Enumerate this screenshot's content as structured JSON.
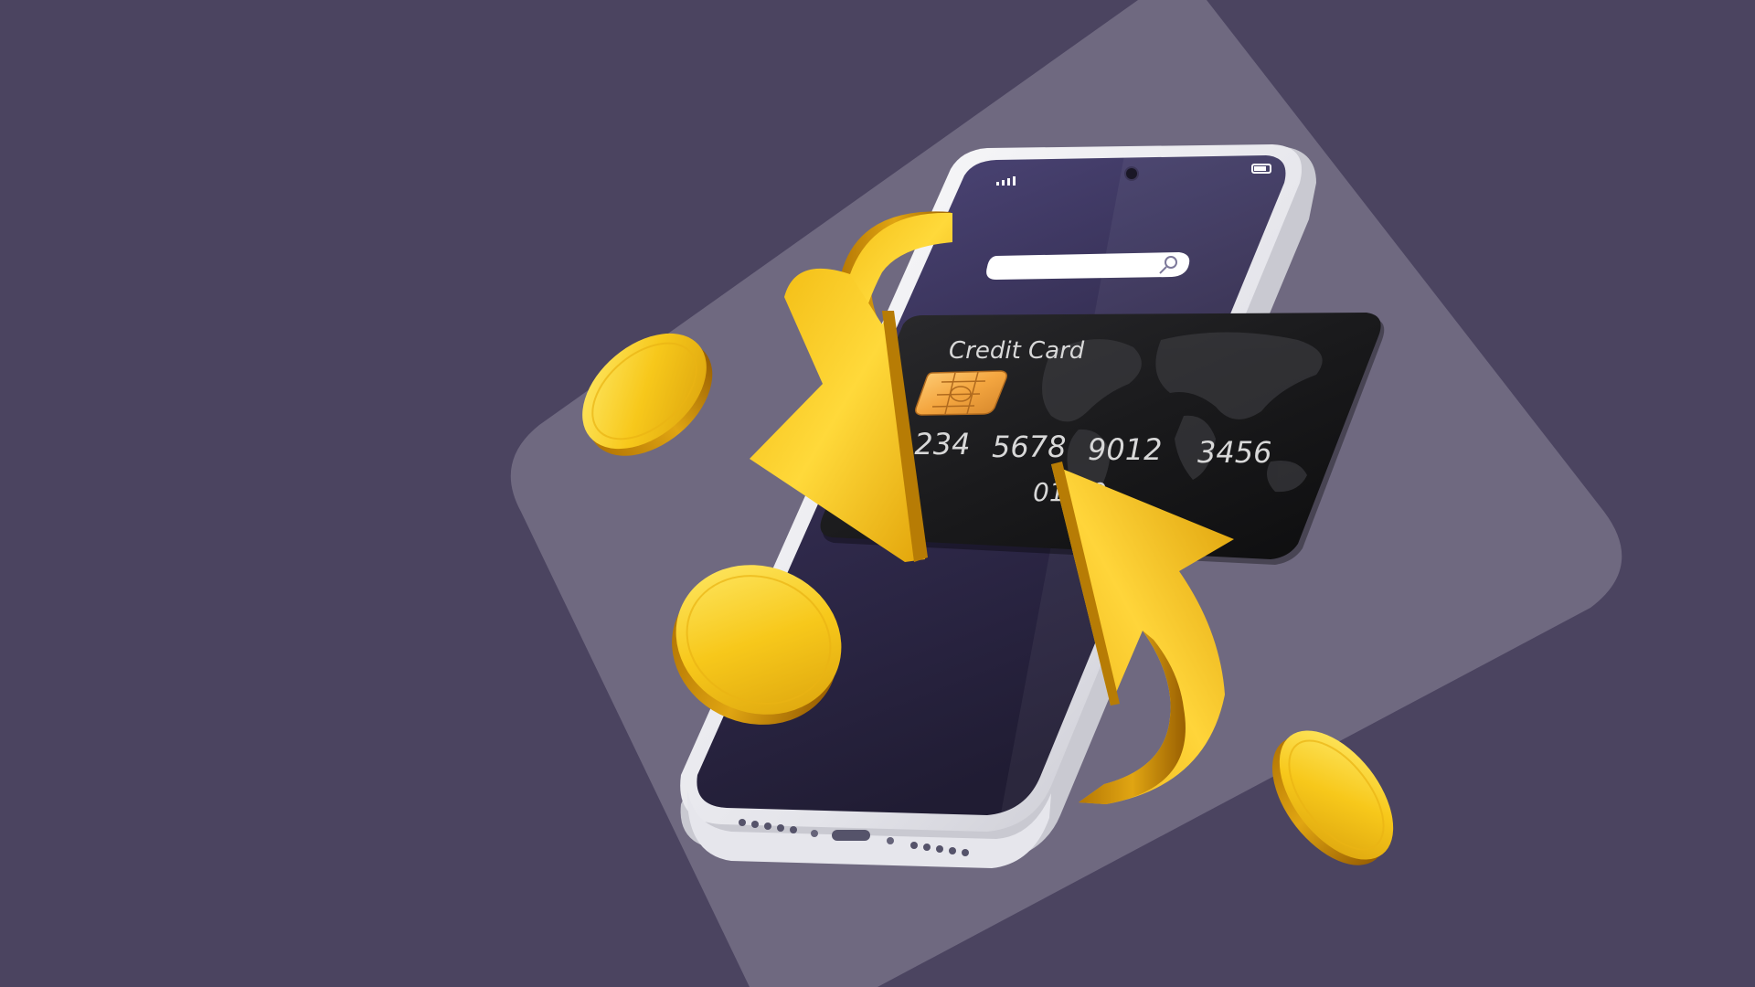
{
  "colors": {
    "background": "#4b4460",
    "backdrop_tile": "#6f6980",
    "phone_screen_top": "#4e467a",
    "phone_screen_bottom": "#1f1b30",
    "phone_body": "#f2f2f4",
    "card": "#1b1b1d",
    "gold_light": "#ffe45a",
    "gold_mid": "#f5c518",
    "gold_dark": "#c68a06",
    "chip": "#f5b24a"
  },
  "icons": [
    "search-icon",
    "signal-icon",
    "battery-icon",
    "camera-icon",
    "chip-icon",
    "world-map-icon",
    "coin-icon",
    "arrow-icon"
  ],
  "phone": {
    "search": {
      "placeholder": ""
    }
  },
  "card": {
    "title": "Credit Card",
    "number": [
      "1234",
      "5678",
      "9012",
      "3456"
    ],
    "expiry": "01/30"
  }
}
